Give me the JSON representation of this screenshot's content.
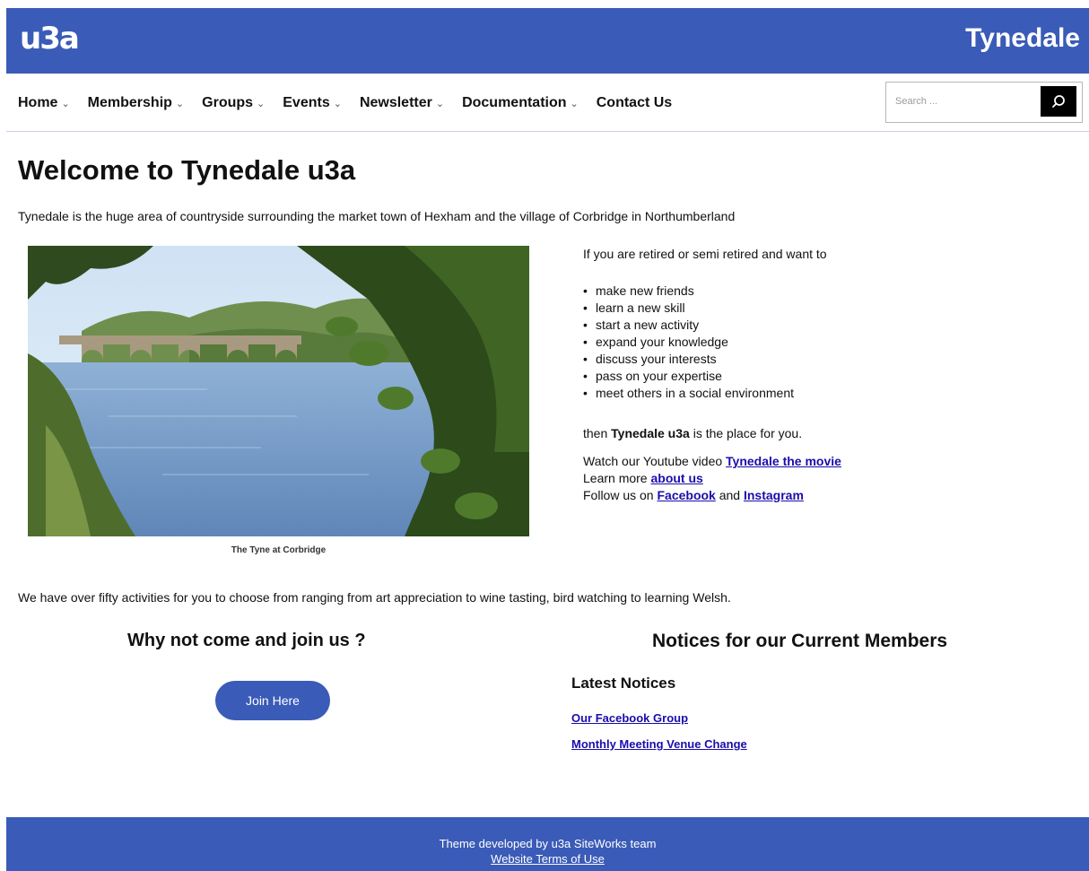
{
  "header": {
    "logo_text": "u3a",
    "site_name": "Tynedale",
    "background_color": "#3a5bb7"
  },
  "nav": {
    "items": [
      {
        "label": "Home",
        "has_submenu": true
      },
      {
        "label": "Membership",
        "has_submenu": true
      },
      {
        "label": "Groups",
        "has_submenu": true
      },
      {
        "label": "Events",
        "has_submenu": true
      },
      {
        "label": "Newsletter",
        "has_submenu": true
      },
      {
        "label": "Documentation",
        "has_submenu": true
      },
      {
        "label": "Contact Us",
        "has_submenu": false
      }
    ],
    "search": {
      "placeholder": "Search ...",
      "value": "",
      "button_icon": "search-icon"
    }
  },
  "main": {
    "title": "Welcome to Tynedale u3a",
    "intro": "Tynedale is the huge area of countryside surrounding the market town of Hexham and the village of Corbridge in Northumberland",
    "figure": {
      "caption": "The Tyne at Corbridge"
    },
    "right_column": {
      "lead": "If you are retired or semi retired and want to",
      "bullets": [
        "make new friends",
        "learn a new skill",
        "start a new activity",
        "expand your knowledge",
        "discuss your interests",
        "pass on your expertise",
        "meet others in a social environment"
      ],
      "then_prefix": "then",
      "then_bold": "Tynedale u3a",
      "then_suffix": "is the place for you.",
      "watch_prefix": "Watch our Youtube video",
      "watch_link": "Tynedale the movie",
      "learn_prefix": "Learn more",
      "learn_link": "about us",
      "follow_prefix": "Follow us on",
      "facebook_link": "Facebook",
      "and_text": "and",
      "instagram_link": "Instagram"
    },
    "activities": "We have over fifty activities for you to choose from ranging from art appreciation to wine tasting, bird watching to learning Welsh.",
    "join": {
      "heading": "Why not come and join us ?",
      "button_label": "Join Here"
    },
    "notices": {
      "heading": "Notices for our Current Members",
      "latest_heading": "Latest Notices",
      "links": [
        "Our Facebook Group",
        "Monthly Meeting Venue Change"
      ]
    }
  },
  "footer": {
    "credit": "Theme developed by u3a SiteWorks team",
    "terms_link": "Website Terms of Use"
  }
}
